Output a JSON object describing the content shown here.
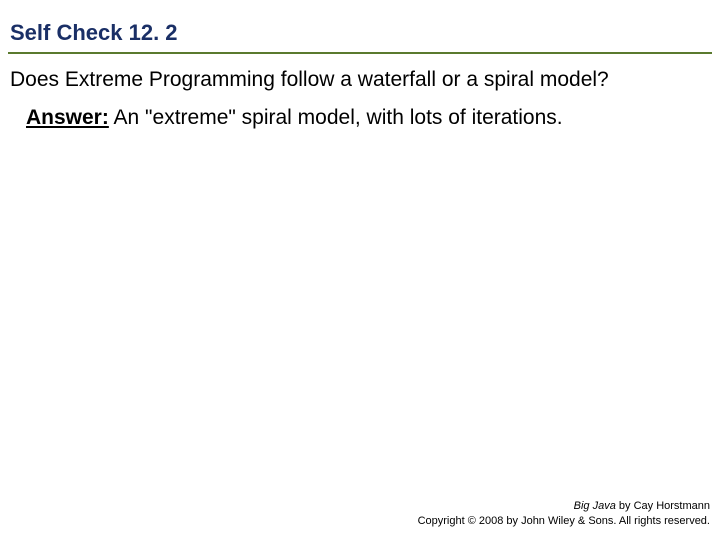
{
  "title": "Self Check 12. 2",
  "question": "Does Extreme Programming follow a waterfall or a spiral model?",
  "answer_label": "Answer:",
  "answer_text": " An \"extreme\" spiral model, with lots of iterations.",
  "footer": {
    "book": "Big Java",
    "byline": " by Cay Horstmann",
    "copyright": "Copyright © 2008 by John Wiley & Sons. All rights reserved."
  }
}
